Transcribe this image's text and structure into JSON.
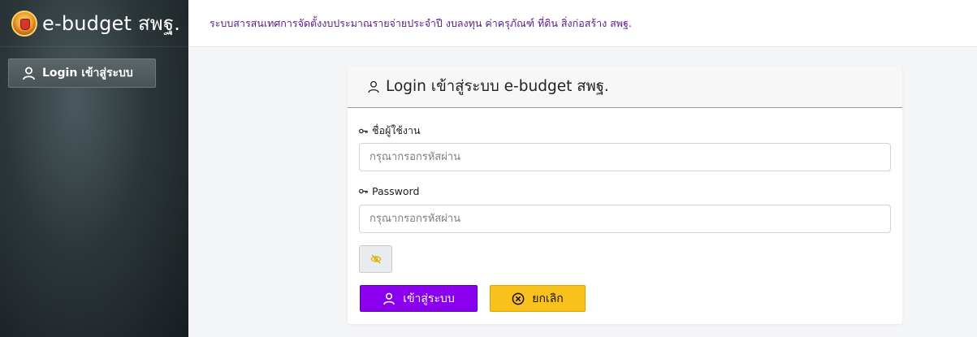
{
  "brand": {
    "title": "e-budget สพฐ.",
    "logo_icon": "obec-emblem"
  },
  "sidebar": {
    "items": [
      {
        "label": "Login เข้าสู่ระบบ",
        "icon": "user-icon"
      }
    ]
  },
  "topbar": {
    "text": "ระบบสารสนเทศการจัดตั้งงบประมาณรายจ่ายประจำปี งบลงทุน ค่าครุภัณฑ์ ที่ดิน สิ่งก่อสร้าง สพฐ."
  },
  "login_card": {
    "title": "Login เข้าสู่ระบบ e-budget สพฐ.",
    "username_label": "ชื่อผู้ใช้งาน",
    "username_placeholder": "กรุณากรอกรหัสผ่าน",
    "username_value": "",
    "password_label": "Password",
    "password_placeholder": "กรุณากรอกรหัสผ่าน",
    "password_value": "",
    "toggle_icon": "eye-slash-icon",
    "login_button": "เข้าสู่ระบบ",
    "cancel_button": "ยกเลิก"
  },
  "colors": {
    "primary_purple": "#8a00ee",
    "warning_yellow": "#f9c11b",
    "topbar_text": "#5a1b86",
    "sidebar_dark": "#2c3639"
  }
}
